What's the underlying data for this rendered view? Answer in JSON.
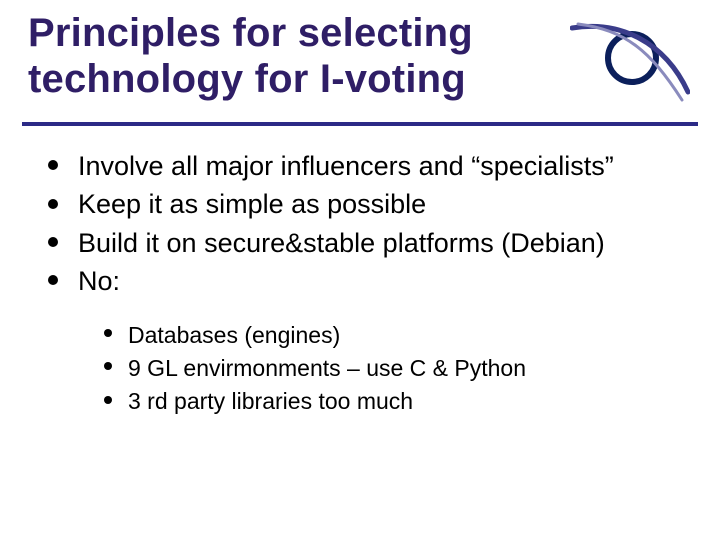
{
  "title": "Principles for selecting technology for I-voting",
  "bullets": [
    "Involve all major influencers and “specialists”",
    "Keep it as simple as possible",
    "Build it on secure&stable platforms (Debian)",
    "No:"
  ],
  "sub_bullets": [
    "Databases (engines)",
    "9 GL envirmonments – use C & Python",
    "3 rd party libraries too much"
  ]
}
